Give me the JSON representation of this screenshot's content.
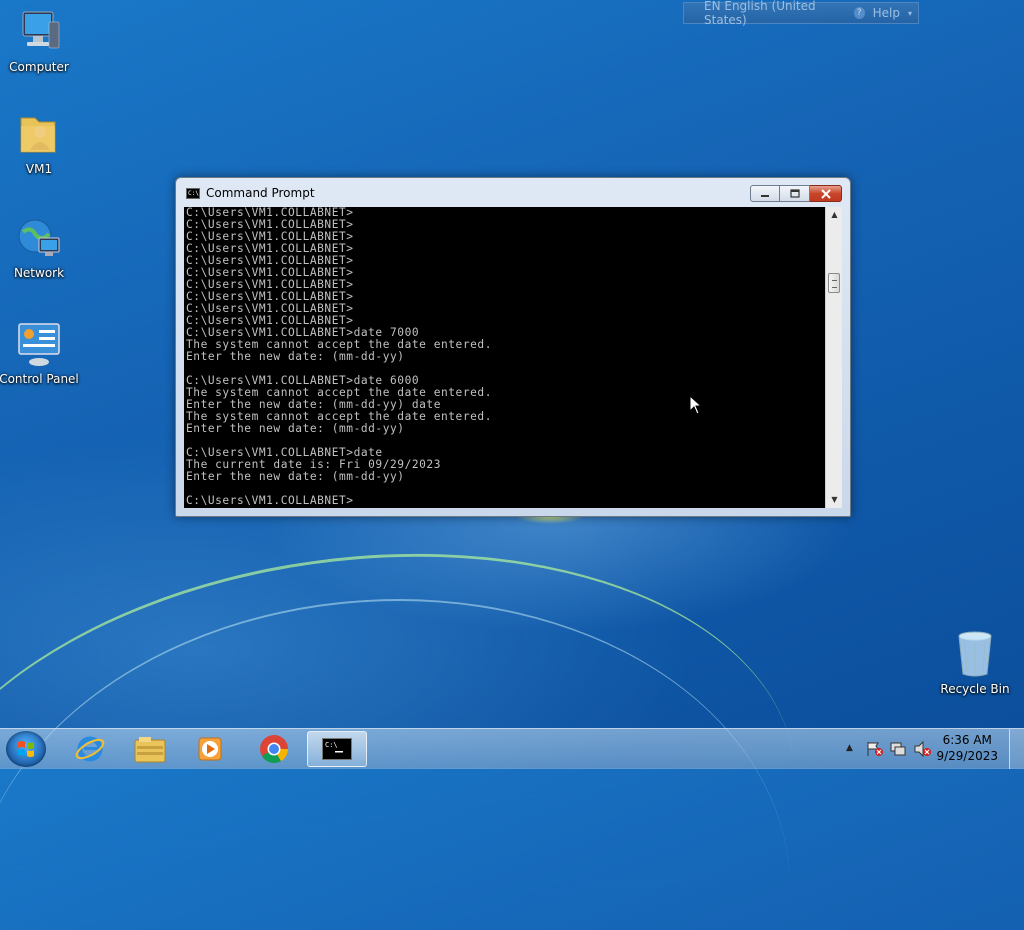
{
  "desktop": {
    "icons": [
      {
        "label": "Computer",
        "icon": "computer-icon"
      },
      {
        "label": "VM1",
        "icon": "user-folder-icon"
      },
      {
        "label": "Network",
        "icon": "network-icon"
      },
      {
        "label": "Control Panel",
        "icon": "control-panel-icon"
      },
      {
        "label": "Recycle Bin",
        "icon": "recycle-bin-icon"
      }
    ]
  },
  "language_bar": {
    "language": "EN English (United States)",
    "help": "Help"
  },
  "window": {
    "title": "Command Prompt",
    "console_text": "C:\\Users\\VM1.COLLABNET>\nC:\\Users\\VM1.COLLABNET>\nC:\\Users\\VM1.COLLABNET>\nC:\\Users\\VM1.COLLABNET>\nC:\\Users\\VM1.COLLABNET>\nC:\\Users\\VM1.COLLABNET>\nC:\\Users\\VM1.COLLABNET>\nC:\\Users\\VM1.COLLABNET>\nC:\\Users\\VM1.COLLABNET>\nC:\\Users\\VM1.COLLABNET>\nC:\\Users\\VM1.COLLABNET>date 7000\nThe system cannot accept the date entered.\nEnter the new date: (mm-dd-yy)\n\nC:\\Users\\VM1.COLLABNET>date 6000\nThe system cannot accept the date entered.\nEnter the new date: (mm-dd-yy) date\nThe system cannot accept the date entered.\nEnter the new date: (mm-dd-yy)\n\nC:\\Users\\VM1.COLLABNET>date\nThe current date is: Fri 09/29/2023\nEnter the new date: (mm-dd-yy)\n\nC:\\Users\\VM1.COLLABNET>"
  },
  "taskbar": {
    "pinned": [
      "internet-explorer-icon",
      "explorer-folder-icon",
      "media-player-icon",
      "chrome-icon",
      "command-prompt-icon"
    ],
    "clock": {
      "time": "6:36 AM",
      "date": "9/29/2023"
    }
  },
  "colors": {
    "console_bg": "#000000",
    "console_text": "#c0c0c0",
    "close_button": "#c8462a"
  }
}
